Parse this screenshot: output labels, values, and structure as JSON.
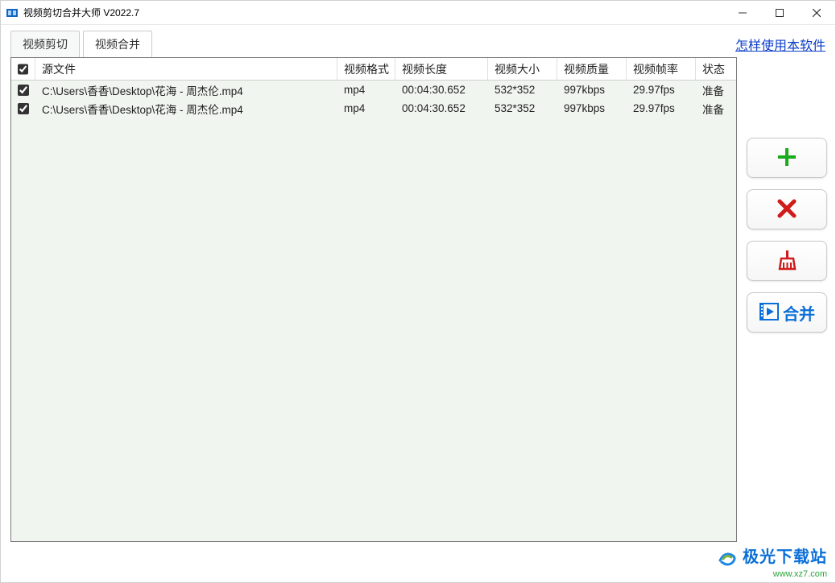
{
  "window": {
    "title": "视频剪切合并大师 V2022.7"
  },
  "tabs": {
    "cut": "视频剪切",
    "merge": "视频合并"
  },
  "help_link": "怎样使用本软件",
  "columns": {
    "source": "源文件",
    "format": "视频格式",
    "duration": "视频长度",
    "size": "视频大小",
    "quality": "视频质量",
    "fps": "视频帧率",
    "status": "状态"
  },
  "rows": [
    {
      "checked": true,
      "source": "C:\\Users\\香香\\Desktop\\花海 - 周杰伦.mp4",
      "format": "mp4",
      "duration": "00:04:30.652",
      "size": "532*352",
      "quality": "997kbps",
      "fps": "29.97fps",
      "status": "准备"
    },
    {
      "checked": true,
      "source": "C:\\Users\\香香\\Desktop\\花海 - 周杰伦.mp4",
      "format": "mp4",
      "duration": "00:04:30.652",
      "size": "532*352",
      "quality": "997kbps",
      "fps": "29.97fps",
      "status": "准备"
    }
  ],
  "buttons": {
    "add": "add-icon",
    "remove": "remove-icon",
    "clear": "clear-icon",
    "merge_label": "合并"
  },
  "footer": {
    "brand": "极光下载站",
    "url": "www.xz7.com"
  }
}
